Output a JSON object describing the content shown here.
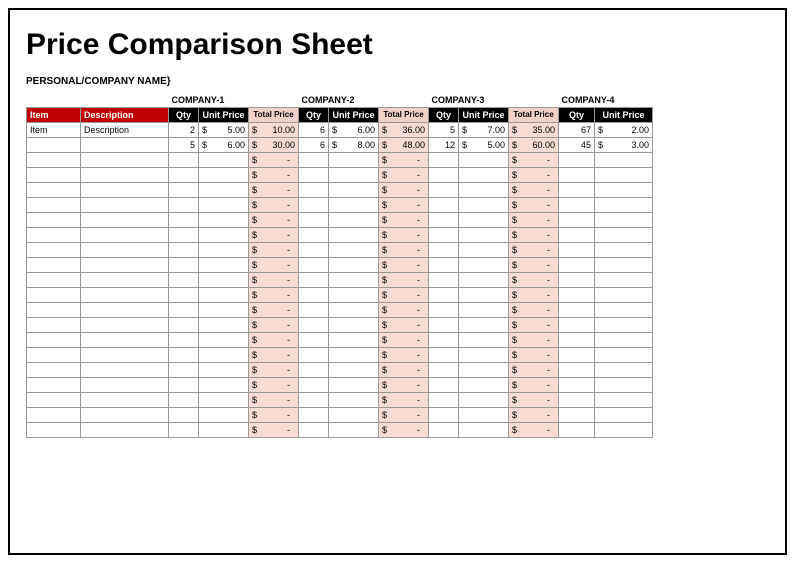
{
  "title": "Price Comparison Sheet",
  "subtitle": "PERSONAL/COMPANY NAME}",
  "companies": [
    "COMPANY-1",
    "COMPANY-2",
    "COMPANY-3",
    "COMPANY-4"
  ],
  "headers": {
    "item": "Item",
    "description": "Description",
    "qty": "Qty",
    "unit_price": "Unit Price",
    "total_price": "Total Price"
  },
  "currency": "$",
  "dash": "-",
  "rows": [
    {
      "item": "Item",
      "description": "Description",
      "c1": {
        "qty": "2",
        "unit": "5.00",
        "total": "10.00"
      },
      "c2": {
        "qty": "6",
        "unit": "6.00",
        "total": "36.00"
      },
      "c3": {
        "qty": "5",
        "unit": "7.00",
        "total": "35.00"
      },
      "c4": {
        "qty": "67",
        "unit": "2.00"
      }
    },
    {
      "item": "",
      "description": "",
      "c1": {
        "qty": "5",
        "unit": "6.00",
        "total": "30.00"
      },
      "c2": {
        "qty": "6",
        "unit": "8.00",
        "total": "48.00"
      },
      "c3": {
        "qty": "12",
        "unit": "5.00",
        "total": "60.00"
      },
      "c4": {
        "qty": "45",
        "unit": "3.00"
      }
    }
  ],
  "empty_row_count": 19,
  "chart_data": {
    "type": "table",
    "title": "Price Comparison Sheet",
    "columns": [
      "Item",
      "Description",
      "C1 Qty",
      "C1 Unit Price",
      "C1 Total",
      "C2 Qty",
      "C2 Unit Price",
      "C2 Total",
      "C3 Qty",
      "C3 Unit Price",
      "C3 Total",
      "C4 Qty",
      "C4 Unit Price"
    ],
    "data": [
      [
        "Item",
        "Description",
        2,
        5.0,
        10.0,
        6,
        6.0,
        36.0,
        5,
        7.0,
        35.0,
        67,
        2.0
      ],
      [
        "",
        "",
        5,
        6.0,
        30.0,
        6,
        8.0,
        48.0,
        12,
        5.0,
        60.0,
        45,
        3.0
      ]
    ]
  }
}
